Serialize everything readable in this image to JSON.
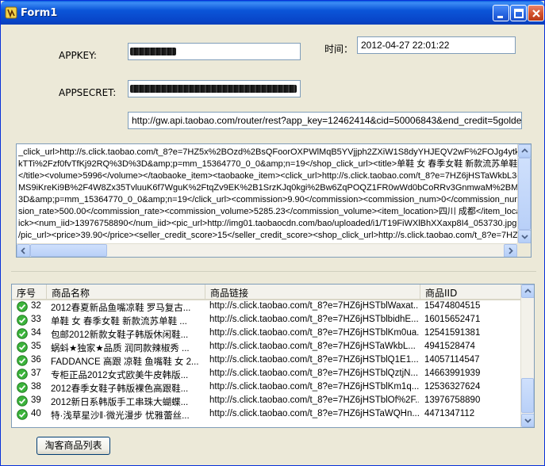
{
  "window": {
    "title": "Form1"
  },
  "form": {
    "appkey_label": "APPKEY:",
    "appsecret_label": "APPSECRET:",
    "time_label": "时间：",
    "time_value": "2012-04-27 22:01:22",
    "url_value": "http://gw.api.taobao.com/router/rest?app_key=12462414&cid=50006843&end_credit=5goldencrown&fi"
  },
  "response": {
    "lines": [
      "_click_url>http://s.click.taobao.com/t_8?e=7HZ5x%2BOzd%2BsQFoorOXPWlMqB5YVjjph2ZXiW1S8dyYHJEQV2wF%2FOJg4ytk%2FC",
      "kTTi%2Fzf0fvTfKj92RQ%3D%3D&amp;p=mm_15364770_0_0&amp;n=19</shop_click_url><title>单鞋 女 春季女鞋 新款流苏单鞋 小",
      "</title><volume>5996</volume></taobaoke_item><taobaoke_item><click_url>http://s.click.taobao.com/t_8?e=7HZ6jHSTaWkbL3qq1",
      "MS9iKreKi9B%2F4W8Zx35TvluuK6f7WguK%2FtqZv9EK%2B1SrzKJq0kgi%2Bw6ZqPOQZ1FR0wWd0bCoRRv3GnmwaM%2BM1ktxCE",
      "3D&amp;p=mm_15364770_0_0&amp;n=19</click_url><commission>9.90</commission><commission_num>0</commission_num><com",
      "sion_rate>500.00</commission_rate><commission_volume>5285.23</commission_volume><item_location>四川 成都</item_location><",
      "ick><num_iid>13976758890</num_iid><pic_url>http://img01.taobaocdn.com/bao/uploaded/i1/T19FiWXlBhXXaxp8I4_053730.jpg</pi",
      "/pic_url><price>39.90</price><seller_credit_score>15</seller_credit_score><shop_click_url>http://s.click.taobao.com/t_8?e=7HZ5x%2"
    ]
  },
  "list": {
    "columns": [
      "序号",
      "商品名称",
      "商品链接",
      "商品IID"
    ],
    "rows": [
      {
        "no": "32",
        "name": "2012春夏新品鱼嘴凉鞋 罗马复古...",
        "link": "http://s.click.taobao.com/t_8?e=7HZ6jHSTblWaxat...",
        "iid": "15474804515"
      },
      {
        "no": "33",
        "name": "单鞋 女 春季女鞋 新款流苏单鞋 ...",
        "link": "http://s.click.taobao.com/t_8?e=7HZ6jHSTblbidhE...",
        "iid": "16015652471"
      },
      {
        "no": "34",
        "name": "包邮2012新款女鞋子韩版休闲鞋...",
        "link": "http://s.click.taobao.com/t_8?e=7HZ6jHSTblKm0ua...",
        "iid": "12541591381"
      },
      {
        "no": "35",
        "name": "蜗蚪★独家★品质 润同款辣椒秀 ...",
        "link": "http://s.click.taobao.com/t_8?e=7HZ6jHSTaWkbL...",
        "iid": "4941528474"
      },
      {
        "no": "36",
        "name": "FADDANCE 高跟 凉鞋 鱼嘴鞋 女 2...",
        "link": "http://s.click.taobao.com/t_8?e=7HZ6jHSTblQ1E1...",
        "iid": "14057114547"
      },
      {
        "no": "37",
        "name": "专柜正品2012女式欧美牛皮韩版...",
        "link": "http://s.click.taobao.com/t_8?e=7HZ6jHSTblQztjN...",
        "iid": "14663991939"
      },
      {
        "no": "38",
        "name": "2012春季女鞋子韩版裸色高跟鞋...",
        "link": "http://s.click.taobao.com/t_8?e=7HZ6jHSTblKm1q...",
        "iid": "12536327624"
      },
      {
        "no": "39",
        "name": "2012新日系韩版手工串珠大蝴蝶...",
        "link": "http://s.click.taobao.com/t_8?e=7HZ6jHSTblOf%2F...",
        "iid": "13976758890"
      },
      {
        "no": "40",
        "name": "特·浅草星沙‖·微光漫步 忧雅蕾丝...",
        "link": "http://s.click.taobao.com/t_8?e=7HZ6jHSTaWQHn...",
        "iid": "4471347112"
      }
    ]
  },
  "buttons": {
    "taoke_list": "淘客商品列表"
  },
  "icons": {
    "window_icon": "app-logo-icon",
    "row_icon": "green-check-icon"
  }
}
